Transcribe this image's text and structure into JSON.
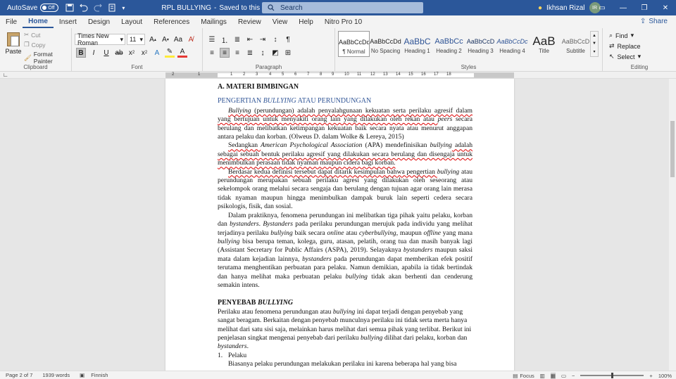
{
  "titlebar": {
    "autosave_label": "AutoSave",
    "autosave_state": "Off",
    "doc_title": "RPL BULLYING",
    "save_status": "Saved to this PC",
    "search_placeholder": "Search",
    "user_name": "Ikhsan Rizal",
    "user_initials": "IR"
  },
  "tabs": [
    "File",
    "Home",
    "Insert",
    "Design",
    "Layout",
    "References",
    "Mailings",
    "Review",
    "View",
    "Help",
    "Nitro Pro 10"
  ],
  "share_label": "Share",
  "ribbon": {
    "clipboard": {
      "paste": "Paste",
      "cut": "Cut",
      "copy": "Copy",
      "format_painter": "Format Painter",
      "label": "Clipboard"
    },
    "font": {
      "name": "Times New Roman",
      "size": "11",
      "label": "Font"
    },
    "paragraph": {
      "label": "Paragraph"
    },
    "styles": {
      "label": "Styles",
      "items": [
        {
          "sample": "AaBbCcDd",
          "name": "¶ Normal"
        },
        {
          "sample": "AaBbCcDd",
          "name": "No Spacing"
        },
        {
          "sample": "AaBbC",
          "name": "Heading 1"
        },
        {
          "sample": "AaBbCc",
          "name": "Heading 2"
        },
        {
          "sample": "AaBbCcD",
          "name": "Heading 3"
        },
        {
          "sample": "AaBbCcDc",
          "name": "Heading 4"
        },
        {
          "sample": "AaB",
          "name": "Title"
        },
        {
          "sample": "AaBbCcD",
          "name": "Subtitle"
        }
      ]
    },
    "editing": {
      "find": "Find",
      "replace": "Replace",
      "select": "Select",
      "label": "Editing"
    }
  },
  "ruler_labels": [
    "2",
    "1",
    "1",
    "2",
    "3",
    "4",
    "5",
    "6",
    "7",
    "8",
    "9",
    "10",
    "11",
    "12",
    "13",
    "14",
    "15",
    "16",
    "17",
    "18"
  ],
  "document": {
    "heading_a": "A.  MATERI BIMBINGAN",
    "sub_heading_pre": "PENGERTIAN ",
    "sub_heading_em": "BULLYING",
    "sub_heading_post": " ATAU PERUNDUNGAN",
    "p1": {
      "a": "Bullying",
      "b": " (perundungan) adalah penyalahgunaan kekuatan serta perilaku agresif dalam yang bertujuan untuk menyakiti orang lain yang dilakukan oleh rekan atau ",
      "c": "peers",
      "d": " secara berulang dan melibatkan ketimpangan kekuatan baik secara nyata atau menurut anggapan antara pelaku dan korban. (Olweus D. dalam Wolke & Lereya, 2015)"
    },
    "p2": {
      "a": "Sedangkan ",
      "b": "American Psychological Association",
      "c": " (APA) mendefinisikan ",
      "d": "bullying",
      "e": " adalah sebagai sebuah bentuk perilaku agresif yang dilakukan secara berulang dan disengaja untuk menimbulkan perasaan tidak nyaman maupun cidera bagi korban."
    },
    "p3": {
      "a": "Berdasar kedua definisi tersebut dapat ditarik kesimpulan bahwa pengertian ",
      "b": "bullying",
      "c": " atau perundungan merupakan sebuah perilaku agresi yang dilakukan oleh seseorang atau sekelompok orang melalui secara sengaja dan berulang dengan tujuan agar orang lain merasa tidak nyaman maupun hingga menimbulkan dampak buruk lain seperti cedera secara psikologis, fisik, dan sosial."
    },
    "p4": {
      "a": "Dalam praktiknya, fenomena perundungan ini melibatkan tiga pihak yaitu pelaku, korban dan ",
      "b": "bystanders",
      "c": ". ",
      "d": "Bystanders",
      "e": " pada perilaku perundungan merujuk pada individu yang melihat terjadinya perilaku ",
      "f": "bullying",
      "g": " baik secara ",
      "h": "online",
      "i": " atau ",
      "j": "cyberbullying",
      "k": ", maupun ",
      "l": "offline",
      "m": " yang mana ",
      "n": "bullying",
      "o": " bisa berupa teman, kolega, guru, atasan, pelatih, orang tua dan masih banyak lagi (Assistant Secretary for Public Affairs (ASPA), 2019). Selayaknya ",
      "p": "bystanders",
      "q": " maupun saksi mata dalam kejadian lainnya, ",
      "r": "bystanders",
      "s": " pada perundungan dapat memberikan efek positif terutama menghentikan perbuatan para pelaku. Namun demikian, apabila ia tidak bertindak dan hanya melihat maka perbuatan pelaku ",
      "t": "bullying",
      "u": " tidak akan berhenti dan cenderung semakin intens."
    },
    "heading_b_pre": "PENYEBAB ",
    "heading_b_em": "BULLYING",
    "p5": {
      "a": "Perilaku atau fenomena perundungan atau ",
      "b": "bullying",
      "c": " ini dapat terjadi dengan penyebab yang sangat beragam. Berkaitan dengan penyebab munculnya perilaku ini tidak serta merta hanya melihat dari satu sisi saja, melainkan harus melihat dari semua pihak yang terlibat. Berikut ini penjelasan singkat mengenai penyebab dari perilaku ",
      "d": "bullying",
      "e": " dilihat dari pelaku, korban dan ",
      "f": "bystanders",
      "g": "."
    },
    "list1_num": "1.",
    "list1_text": "Pelaku",
    "p6": "Biasanya pelaku perundungan melakukan perilaku ini karena beberapa hal yang bisa"
  },
  "status": {
    "page": "Page 2 of 7",
    "words": "1939 words",
    "language": "Finnish",
    "focus": "Focus",
    "zoom": "100%"
  }
}
